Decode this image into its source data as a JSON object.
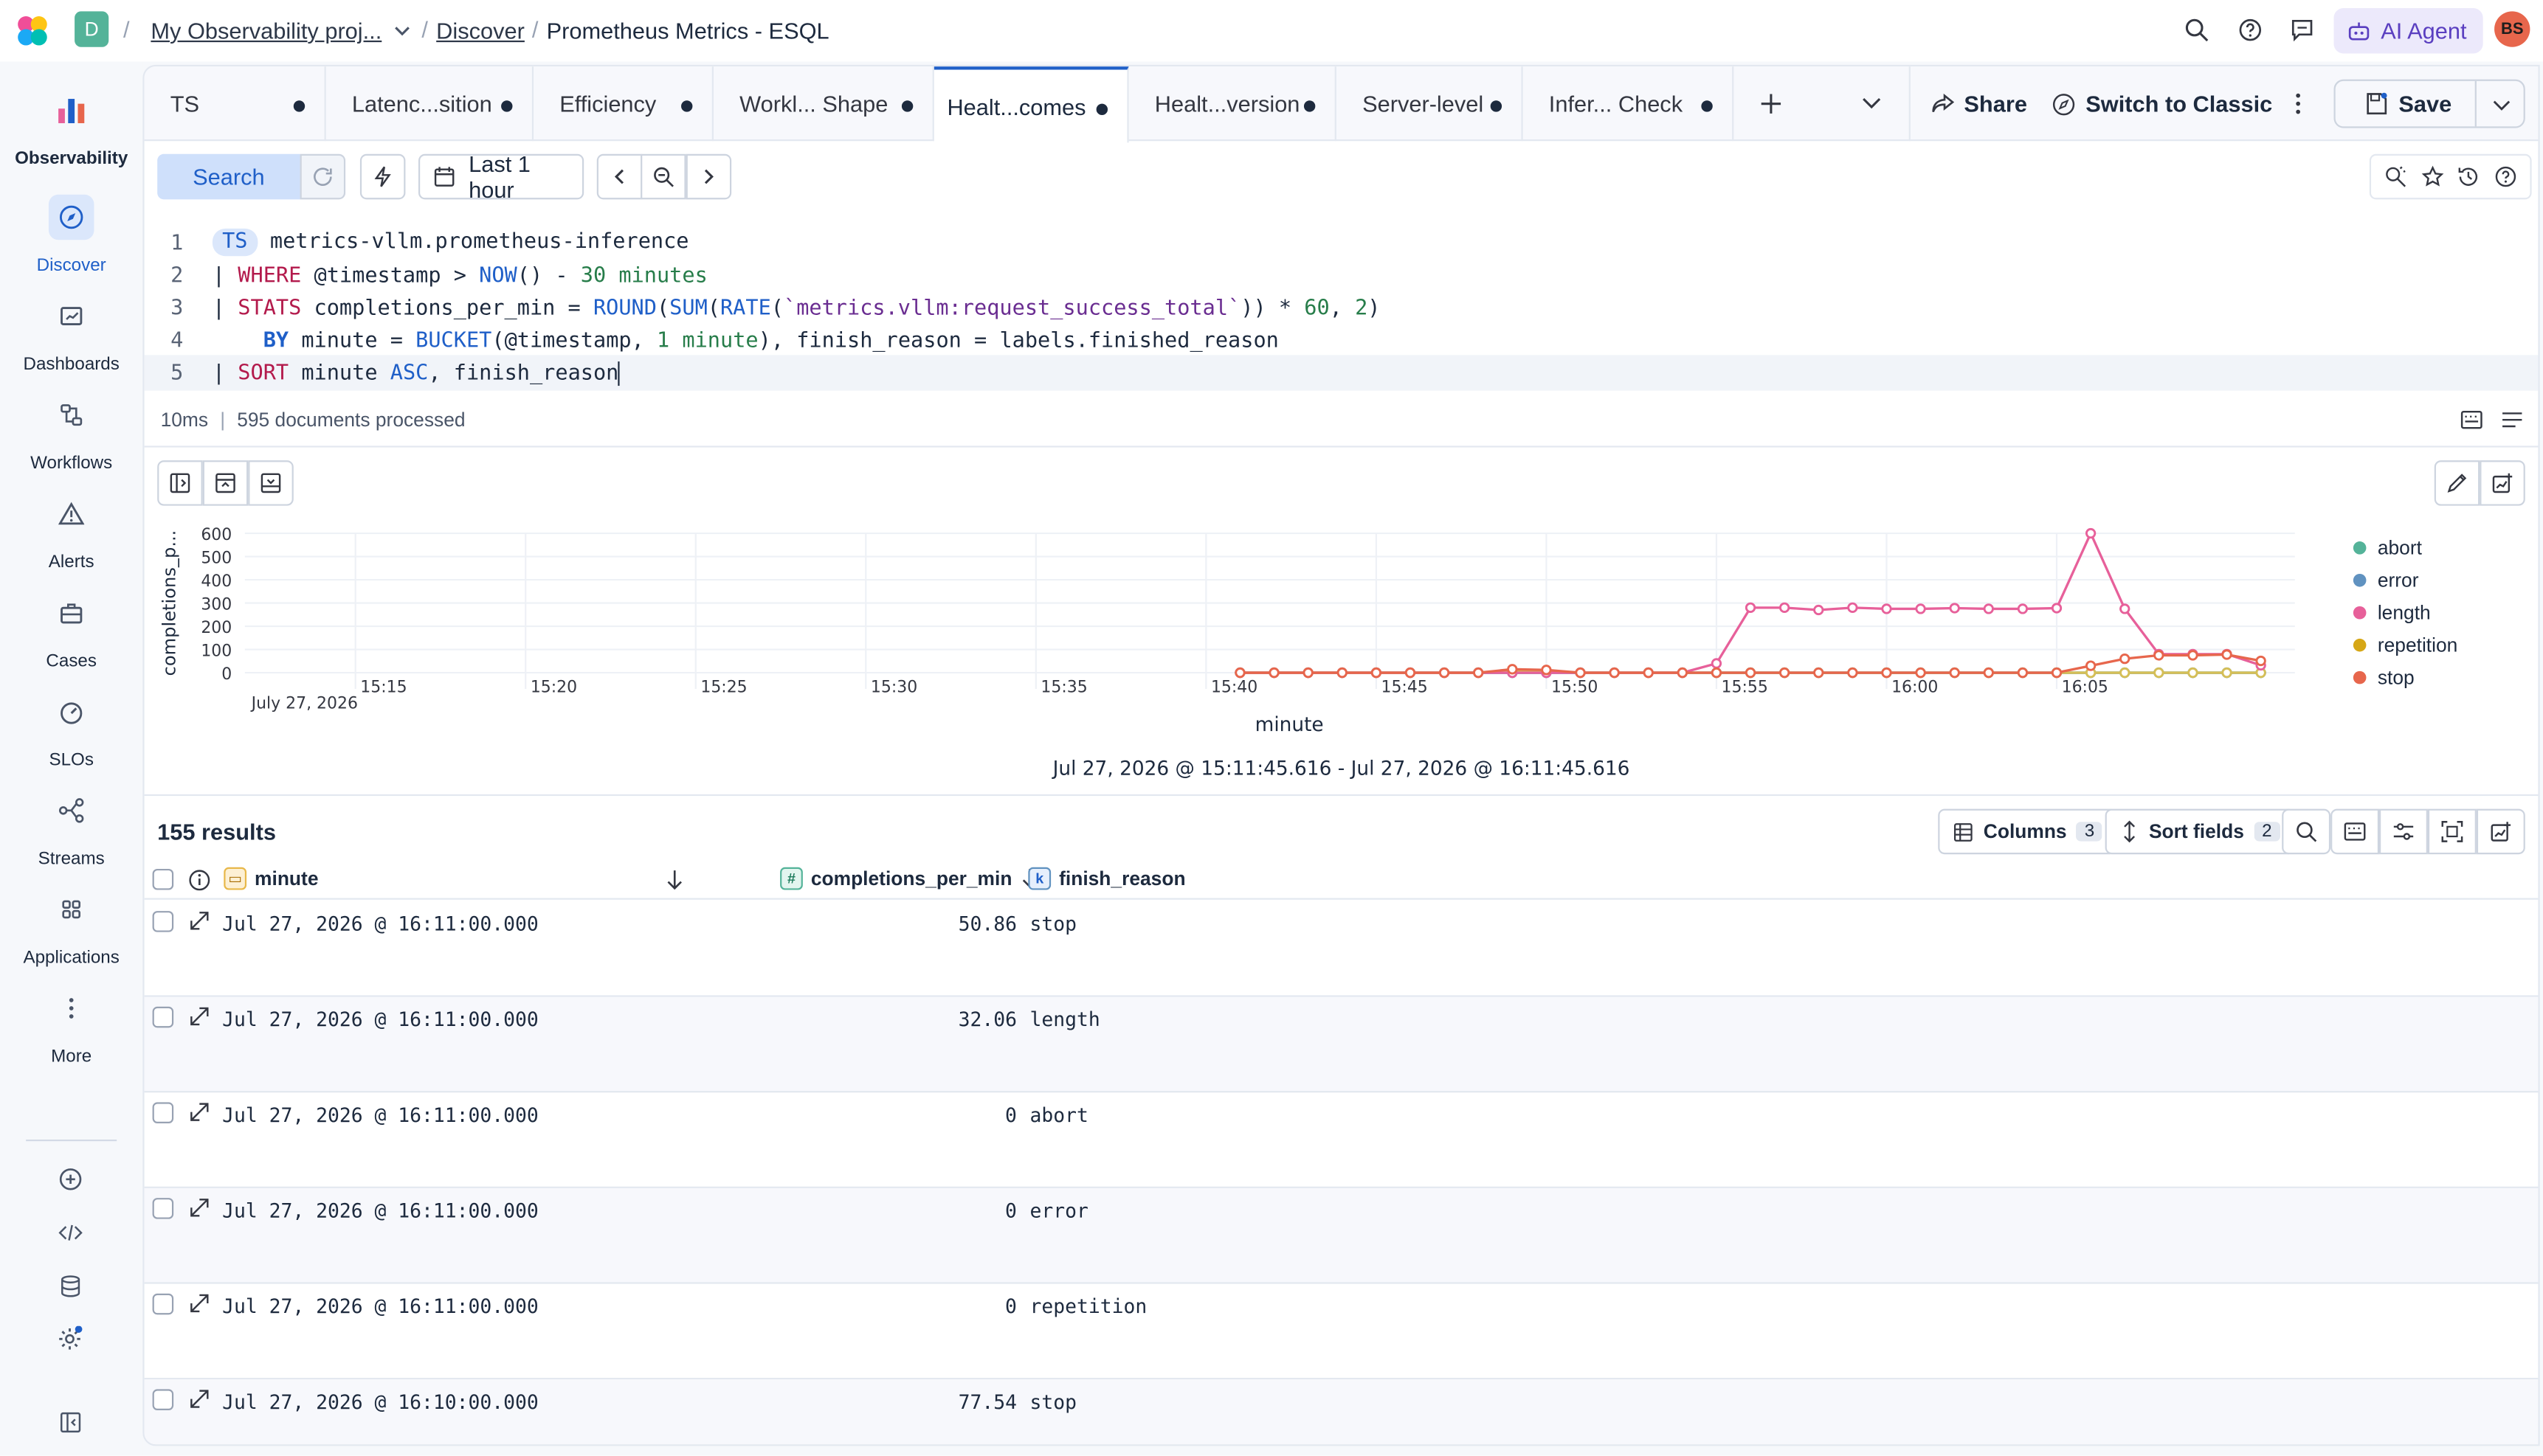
{
  "topbar": {
    "space_letter": "D",
    "project": "My Observability proj...",
    "breadcrumb_discover": "Discover",
    "page_title": "Prometheus Metrics - ESQL",
    "ai_agent": "AI Agent",
    "avatar": "BS"
  },
  "sidebar": {
    "items": [
      {
        "label": "Observability"
      },
      {
        "label": "Discover"
      },
      {
        "label": "Dashboards"
      },
      {
        "label": "Workflows"
      },
      {
        "label": "Alerts"
      },
      {
        "label": "Cases"
      },
      {
        "label": "SLOs"
      },
      {
        "label": "Streams"
      },
      {
        "label": "Applications"
      },
      {
        "label": "More"
      }
    ]
  },
  "tabs": [
    {
      "label": "TS"
    },
    {
      "label": "Latenc...sition"
    },
    {
      "label": "Efficiency"
    },
    {
      "label": "Workl... Shape"
    },
    {
      "label": "Healt...comes"
    },
    {
      "label": "Healt...version"
    },
    {
      "label": "Server-level"
    },
    {
      "label": "Infer... Check"
    }
  ],
  "toolbar": {
    "share": "Share",
    "switch_classic": "Switch to Classic",
    "save": "Save",
    "search": "Search",
    "time_range": "Last 1 hour"
  },
  "editor": {
    "line_numbers": [
      "1",
      "2",
      "3",
      "4",
      "5"
    ]
  },
  "status": {
    "duration": "10ms",
    "docs": "595 documents processed"
  },
  "chart_data": {
    "type": "line",
    "xlabel": "minute",
    "ylabel": "completions_p...",
    "y_ticks": [
      "600",
      "500",
      "400",
      "300",
      "200",
      "100",
      "0"
    ],
    "ylim": [
      0,
      600
    ],
    "x_ticks": [
      "15:15",
      "15:20",
      "15:25",
      "15:30",
      "15:35",
      "15:40",
      "15:45",
      "15:50",
      "15:55",
      "16:00",
      "16:05"
    ],
    "x_date": "July 27, 2026",
    "time_range": "Jul 27, 2026 @ 15:11:45.616 - Jul 27, 2026 @ 16:11:45.616",
    "legend_position": "right",
    "x_minutes": [
      "15:41",
      "15:42",
      "15:43",
      "15:44",
      "15:45",
      "15:46",
      "15:47",
      "15:48",
      "15:49",
      "15:50",
      "15:51",
      "15:52",
      "15:53",
      "15:54",
      "15:55",
      "15:56",
      "15:57",
      "15:58",
      "15:59",
      "16:00",
      "16:01",
      "16:02",
      "16:03",
      "16:04",
      "16:05",
      "16:06",
      "16:07",
      "16:08",
      "16:09",
      "16:10",
      "16:11"
    ],
    "series": [
      {
        "name": "abort",
        "color": "#54b399",
        "values": [
          0,
          0,
          0,
          0,
          0,
          0,
          0,
          0,
          0,
          0,
          0,
          0,
          0,
          0,
          0,
          0,
          0,
          0,
          0,
          0,
          0,
          0,
          0,
          0,
          0,
          0,
          0,
          0,
          0,
          0,
          0
        ]
      },
      {
        "name": "error",
        "color": "#6092c0",
        "values": [
          0,
          0,
          0,
          0,
          0,
          0,
          0,
          0,
          0,
          0,
          0,
          0,
          0,
          0,
          0,
          0,
          0,
          0,
          0,
          0,
          0,
          0,
          0,
          0,
          0,
          0,
          0,
          0,
          0,
          0,
          0
        ]
      },
      {
        "name": "length",
        "color": "#e7609a",
        "values": [
          0,
          0,
          0,
          0,
          0,
          0,
          0,
          0,
          0,
          0,
          0,
          0,
          0,
          0,
          40,
          280,
          280,
          270,
          280,
          275,
          275,
          278,
          275,
          275,
          278,
          600,
          275,
          80,
          80,
          80,
          32
        ]
      },
      {
        "name": "repetition",
        "color": "#d6bf57",
        "values": [
          0,
          0,
          0,
          0,
          0,
          0,
          0,
          0,
          10,
          5,
          0,
          0,
          0,
          0,
          0,
          0,
          0,
          0,
          0,
          0,
          0,
          0,
          0,
          0,
          0,
          0,
          0,
          0,
          0,
          0,
          0
        ]
      },
      {
        "name": "stop",
        "color": "#e7664c",
        "values": [
          0,
          0,
          0,
          0,
          0,
          0,
          0,
          0,
          15,
          12,
          0,
          0,
          0,
          0,
          0,
          0,
          0,
          0,
          0,
          0,
          0,
          0,
          0,
          0,
          0,
          30,
          60,
          75,
          75,
          78,
          51
        ]
      }
    ]
  },
  "results": {
    "count": "155 results",
    "columns_label": "Columns",
    "columns_count": "3",
    "sort_label": "Sort fields",
    "sort_count": "2",
    "headers": {
      "minute": "minute",
      "completions": "completions_per_min",
      "finish": "finish_reason"
    },
    "rows": [
      {
        "minute": "Jul 27, 2026 @ 16:11:00.000",
        "value": "50.86",
        "reason": "stop"
      },
      {
        "minute": "Jul 27, 2026 @ 16:11:00.000",
        "value": "32.06",
        "reason": "length"
      },
      {
        "minute": "Jul 27, 2026 @ 16:11:00.000",
        "value": "0",
        "reason": "abort"
      },
      {
        "minute": "Jul 27, 2026 @ 16:11:00.000",
        "value": "0",
        "reason": "error"
      },
      {
        "minute": "Jul 27, 2026 @ 16:11:00.000",
        "value": "0",
        "reason": "repetition"
      },
      {
        "minute": "Jul 27, 2026 @ 16:10:00.000",
        "value": "77.54",
        "reason": "stop"
      }
    ]
  }
}
